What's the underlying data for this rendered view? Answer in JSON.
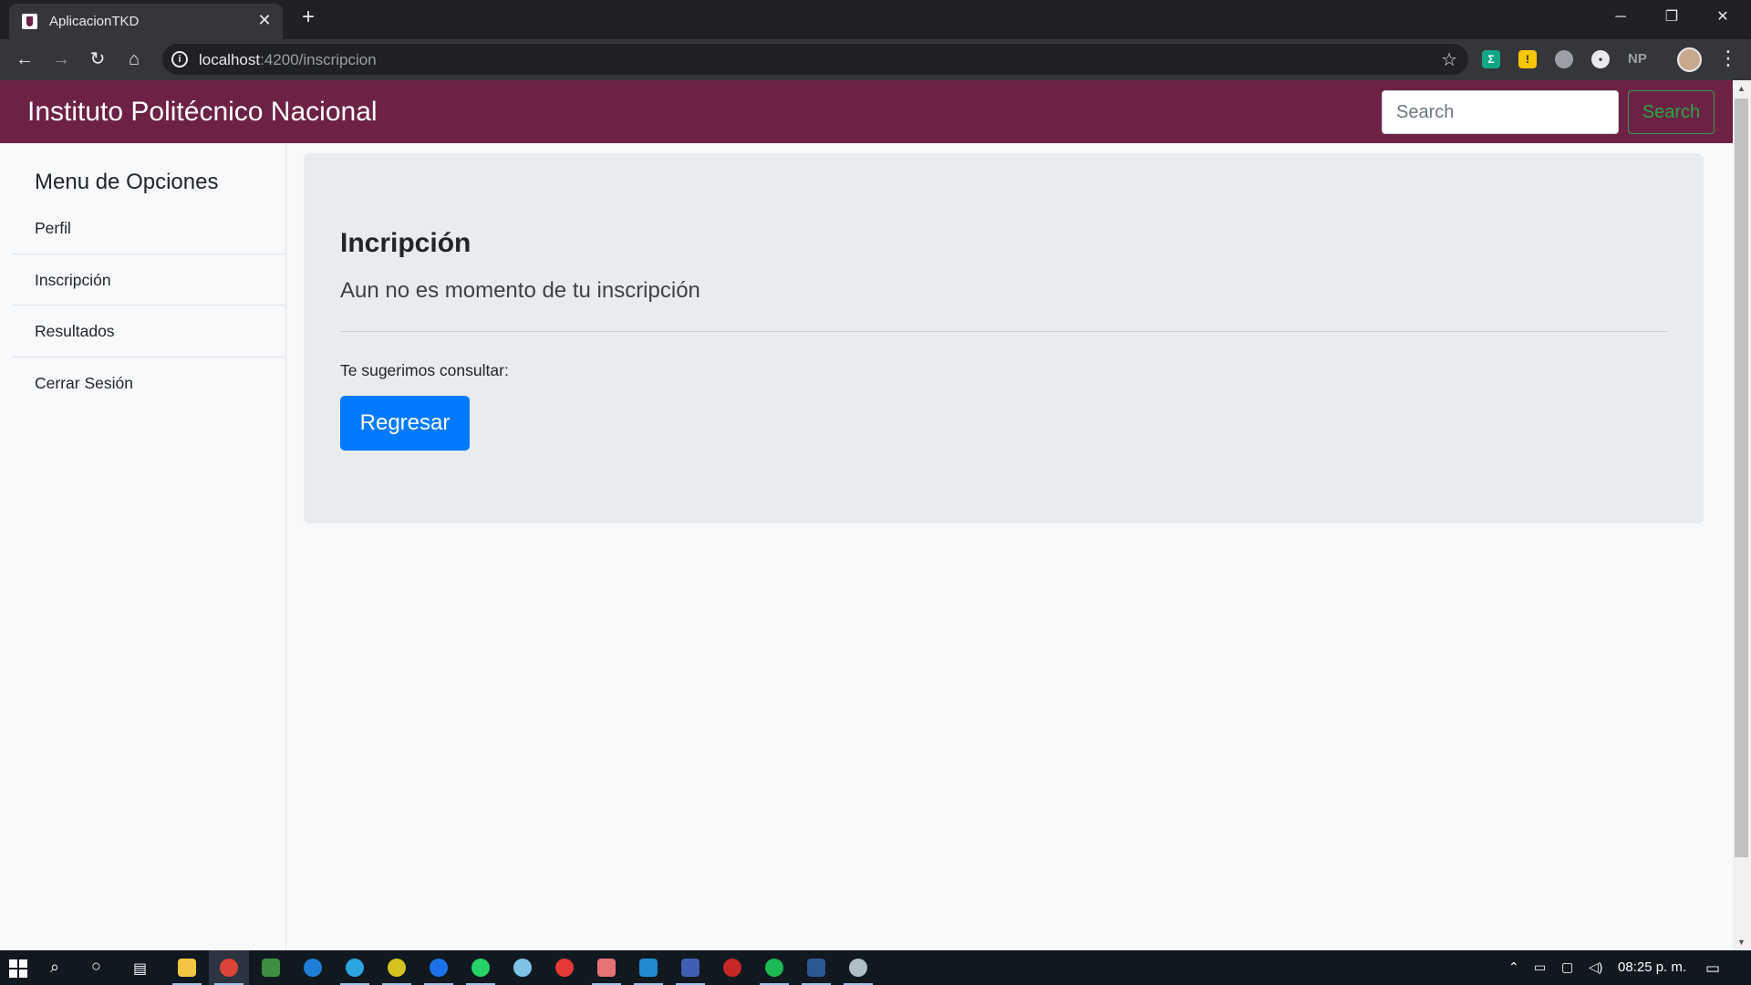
{
  "browser": {
    "tab_title": "AplicacionTKD",
    "url_host": "localhost",
    "url_rest": ":4200/inscripcion",
    "extensions": [
      "NP"
    ]
  },
  "navbar": {
    "brand": "Instituto Politécnico Nacional",
    "search_placeholder": "Search",
    "search_button": "Search"
  },
  "sidebar": {
    "heading": "Menu de Opciones",
    "items": [
      {
        "label": "Perfil"
      },
      {
        "label": "Inscripción"
      },
      {
        "label": "Resultados"
      },
      {
        "label": "Cerrar Sesión"
      }
    ]
  },
  "main": {
    "title": "Incripción",
    "lead": "Aun no es momento de tu inscripción",
    "suggest": "Te sugerimos consultar:",
    "button": "Regresar"
  },
  "taskbar": {
    "time": "08:25 p. m."
  },
  "colors": {
    "navbar": "#6d2245",
    "primary": "#007bff",
    "success": "#28a745",
    "jumbotron": "#e9ecef"
  }
}
